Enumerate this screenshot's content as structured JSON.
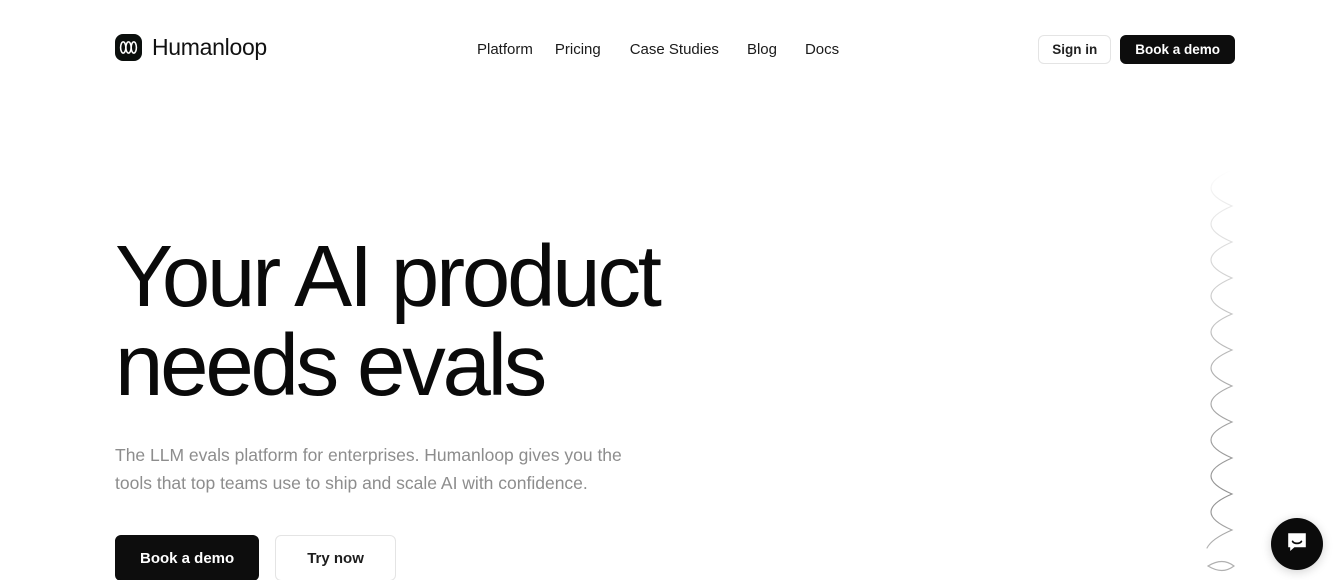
{
  "header": {
    "brand": {
      "name": "Humanloop",
      "logo_icon": "humanloop-logo-icon"
    },
    "nav": [
      {
        "label": "Platform"
      },
      {
        "label": "Pricing"
      },
      {
        "label": "Case Studies"
      },
      {
        "label": "Blog"
      },
      {
        "label": "Docs"
      }
    ],
    "actions": {
      "sign_in_label": "Sign in",
      "book_demo_label": "Book a demo"
    }
  },
  "hero": {
    "title_line_1": "Your AI product",
    "title_line_2": "needs evals",
    "sub_line_1": "The LLM evals platform for enterprises. Humanloop gives you the",
    "sub_line_2": "tools that top teams use to ship and scale AI with confidence.",
    "primary_cta": "Book a demo",
    "secondary_cta": "Try now"
  },
  "decor": {
    "coil_icon": "spiral-coil-decoration"
  },
  "chat": {
    "launcher_icon": "chat-bubble-icon"
  },
  "colors": {
    "page_background": "#ffffff",
    "text_primary": "#0a0a0a",
    "text_muted": "#8d8d8d",
    "button_dark": "#0d0d0d",
    "button_border": "#e4e4e4",
    "coil_line": "#b9b9b9",
    "chat_background": "#0b0b0b"
  }
}
